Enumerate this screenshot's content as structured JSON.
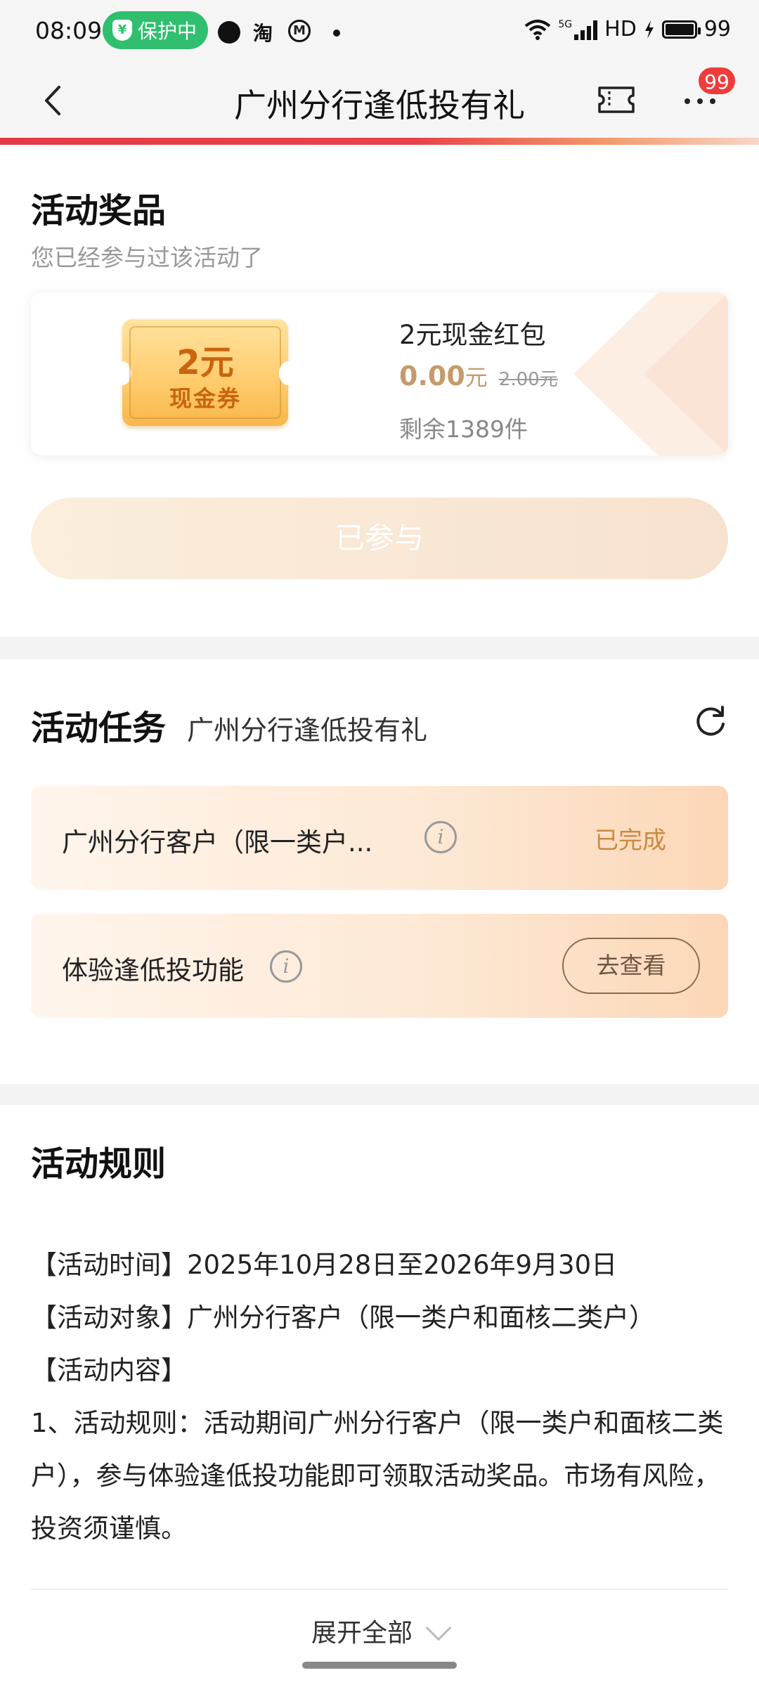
{
  "status_bar": {
    "time": "08:09",
    "protect_label": "保护中",
    "app_icon_tao": "淘",
    "hd": "HD",
    "battery": "99",
    "network": "5G"
  },
  "header": {
    "title": "广州分行逢低投有礼",
    "badge": "99"
  },
  "prize": {
    "section_title": "活动奖品",
    "subtitle": "您已经参与过该活动了",
    "coupon_amount": "2元",
    "coupon_label": "现金券",
    "name": "2元现金红包",
    "price_now": "0.00",
    "price_unit": "元",
    "price_old": "2.00元",
    "stock": "剩余1389件",
    "button_label": "已参与"
  },
  "tasks": {
    "section_title": "活动任务",
    "subtitle": "广州分行逢低投有礼",
    "items": [
      {
        "label": "广州分行客户（限一类户...",
        "status": "已完成"
      },
      {
        "label": "体验逢低投功能",
        "action": "去查看"
      }
    ]
  },
  "rules": {
    "section_title": "活动规则",
    "lines": [
      "【活动时间】2025年10月28日至2026年9月30日",
      "【活动对象】广州分行客户（限一类户和面核二类户）",
      "【活动内容】",
      "1、活动规则：活动期间广州分行客户（限一类户和面核二类户），参与体验逢低投功能即可领取活动奖品。市场有风险，投资须谨慎。"
    ],
    "expand_label": "展开全部"
  },
  "colors": {
    "accent_red": "#e43a45",
    "protect_green": "#2fbf6e",
    "gold": "#c69a6a"
  }
}
